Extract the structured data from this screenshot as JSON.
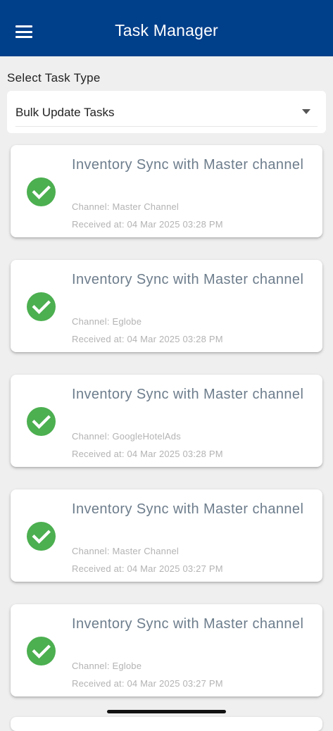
{
  "header": {
    "title": "Task Manager",
    "menu_icon": "hamburger-menu-icon",
    "background_color": "#003f8a"
  },
  "filter": {
    "label": "Select Task Type",
    "selected": "Bulk Update Tasks",
    "dropdown_icon": "caret-down-icon"
  },
  "tasks": [
    {
      "title": "Inventory Sync with Master channel",
      "channel": "Channel: Master Channel",
      "received": "Received at: 04 Mar 2025 03:28 PM",
      "status_icon": "check-circle-icon"
    },
    {
      "title": "Inventory Sync with Master channel",
      "channel": "Channel: Eglobe",
      "received": "Received at: 04 Mar 2025 03:28 PM",
      "status_icon": "check-circle-icon"
    },
    {
      "title": "Inventory Sync with Master channel",
      "channel": "Channel: GoogleHotelAds",
      "received": "Received at: 04 Mar 2025 03:28 PM",
      "status_icon": "check-circle-icon"
    },
    {
      "title": "Inventory Sync with Master channel",
      "channel": "Channel: Master Channel",
      "received": "Received at: 04 Mar 2025 03:27 PM",
      "status_icon": "check-circle-icon"
    },
    {
      "title": "Inventory Sync with Master channel",
      "channel": "Channel: Eglobe",
      "received": "Received at: 04 Mar 2025 03:27 PM",
      "status_icon": "check-circle-icon"
    }
  ],
  "colors": {
    "success": "#4caf50",
    "title_text": "#6d7d8c",
    "meta_text": "#b3b3b3"
  }
}
